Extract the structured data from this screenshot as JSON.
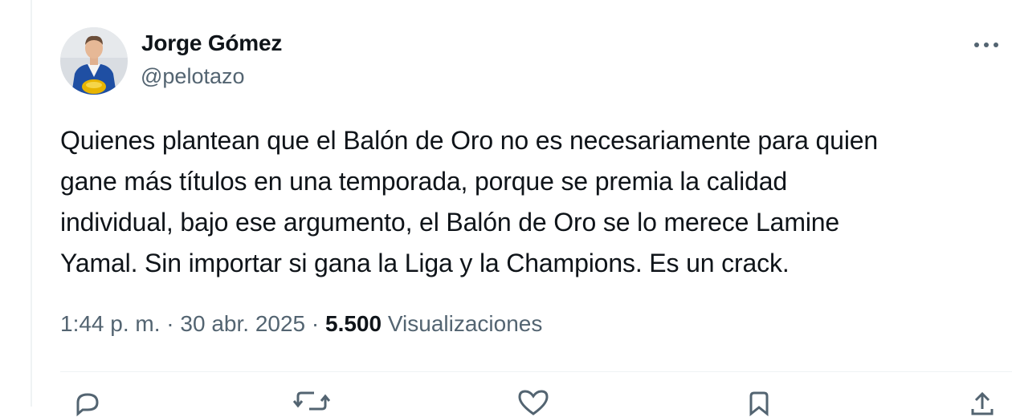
{
  "tweet": {
    "author": {
      "display_name": "Jorge Gómez",
      "handle": "@pelotazo"
    },
    "text": "Quienes plantean que el Balón de Oro no es necesariamente para quien\ngane más títulos en una temporada, porque se premia la calidad\nindividual, bajo ese argumento, el Balón de Oro se lo merece Lamine\nYamal. Sin importar si gana la Liga y la Champions. Es un crack.",
    "time": "1:44 p. m.",
    "separator": "·",
    "date": "30 abr. 2025",
    "views_count": "5.500",
    "views_label": "Visualizaciones"
  },
  "icons": {
    "more": "more-horizontal-icon",
    "reply": "reply-icon",
    "retweet": "retweet-icon",
    "like": "heart-icon",
    "bookmark": "bookmark-icon",
    "share": "share-icon"
  },
  "colors": {
    "text_primary": "#0f1419",
    "text_secondary": "#536471",
    "divider": "#eff3f4",
    "avatar_jacket": "#1f4fa3",
    "avatar_ball": "#e8b400"
  }
}
